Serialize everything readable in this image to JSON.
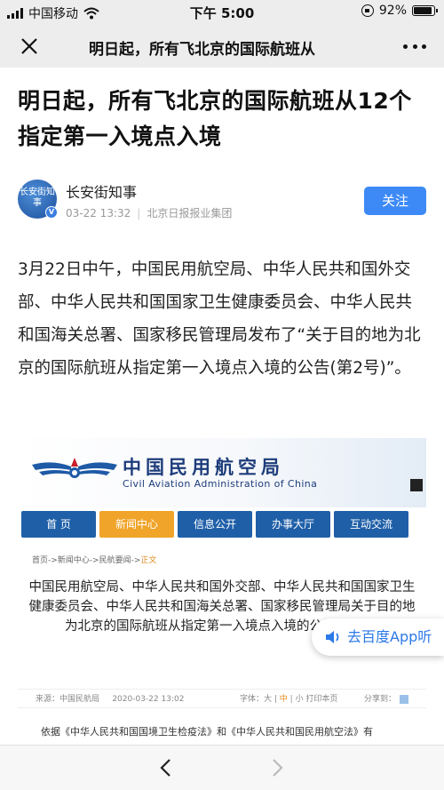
{
  "status_bar": {
    "carrier": "中国移动",
    "time": "下午 5:00",
    "battery": "92%"
  },
  "nav": {
    "title": "明日起，所有飞北京的国际航班从"
  },
  "article": {
    "title": "明日起，所有飞北京的国际航班从12个指定第一入境点入境",
    "author": "长安街知事",
    "avatar_text": "长安街知事",
    "verified_mark": "V",
    "date": "03-22 13:32",
    "publisher": "北京日报报业集团",
    "follow_label": "关注",
    "body": "3月22日中午，中国民用航空局、中华人民共和国外交部、中华人民共和国国家卫生健康委员会、中华人民共和国海关总署、国家移民管理局发布了“关于目的地为北京的国际航班从指定第一入境点入境的公告(第2号)”。"
  },
  "embed": {
    "org_name_cn": "中国民用航空局",
    "org_name_en": "Civil Aviation Administration of China",
    "nav_tabs": [
      "首 页",
      "新闻中心",
      "信息公开",
      "办事大厅",
      "互动交流"
    ],
    "active_tab": 1,
    "breadcrumb_path": "首页->新闻中心->民航要闻->",
    "breadcrumb_current": "正文",
    "title": "中国民用航空局、中华人民共和国外交部、中华人民共和国国家卫生健康委员会、中华人民共和国海关总署、国家移民管理局关于目的地为北京的国际航班从指定第一入境点入境的公告(第2号)",
    "source": "来源：中国民航局",
    "publish_date": "2020-03-22 13:02",
    "font_size_label": "字体：大",
    "font_mid": "中",
    "font_small_print": "小  打印本页",
    "share_label": "分享到：",
    "body_start": "依据《中华人民共和国国境卫生检疫法》和《中华人民共和国民用航空法》有"
  },
  "listen_button": {
    "label": "去百度App听"
  },
  "colors": {
    "accent_blue": "#3d8af7",
    "caac_blue": "#1f5fa8",
    "caac_orange": "#f0a429"
  }
}
